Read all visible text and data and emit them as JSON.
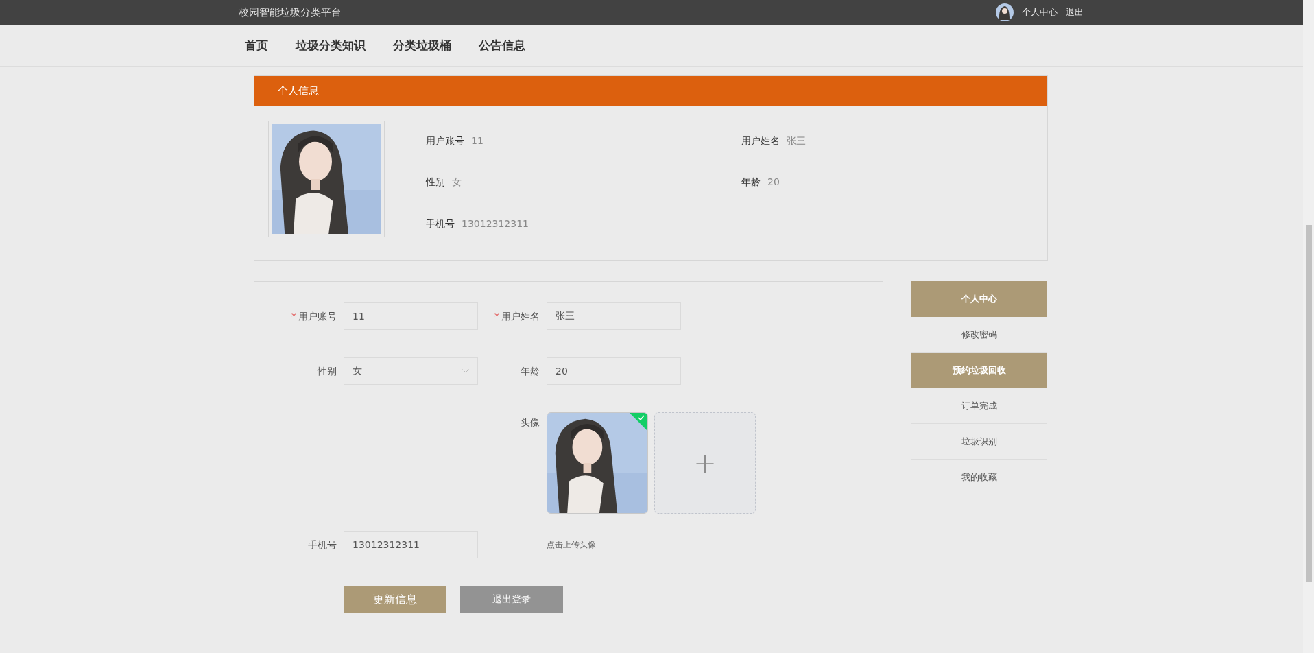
{
  "top_bar": {
    "site_title": "校园智能垃圾分类平台",
    "links": [
      {
        "label": "个人中心"
      },
      {
        "label": "退出"
      }
    ]
  },
  "nav": {
    "items": [
      {
        "label": "首页"
      },
      {
        "label": "垃圾分类知识"
      },
      {
        "label": "分类垃圾桶"
      },
      {
        "label": "公告信息"
      }
    ]
  },
  "info_card": {
    "title": "个人信息",
    "fields": [
      {
        "label": "用户账号",
        "value": "11"
      },
      {
        "label": "用户姓名",
        "value": "张三"
      },
      {
        "label": "性别",
        "value": "女"
      },
      {
        "label": "年龄",
        "value": "20"
      },
      {
        "label": "手机号",
        "value": "13012312311"
      }
    ]
  },
  "form": {
    "account": {
      "label": "用户账号",
      "required_mark": "*",
      "value": "11"
    },
    "name": {
      "label": "用户姓名",
      "required_mark": "*",
      "value": "张三"
    },
    "gender": {
      "label": "性别",
      "value": "女"
    },
    "age": {
      "label": "年龄",
      "value": "20"
    },
    "avatar": {
      "label": "头像",
      "uploaded": true,
      "add_symbol": "+",
      "hint": "点击上传头像"
    },
    "phone": {
      "label": "手机号",
      "value": "13012312311"
    },
    "buttons": [
      {
        "label": "更新信息",
        "kind": "primary"
      },
      {
        "label": "退出登录",
        "kind": "secondary"
      }
    ]
  },
  "side_menu": [
    {
      "label": "个人中心",
      "highlighted": true
    },
    {
      "label": "修改密码",
      "highlighted": false
    },
    {
      "label": "预约垃圾回收",
      "highlighted": true
    },
    {
      "label": "订单完成",
      "highlighted": false
    },
    {
      "label": "垃圾识别",
      "highlighted": false
    },
    {
      "label": "我的收藏",
      "highlighted": false
    }
  ]
}
